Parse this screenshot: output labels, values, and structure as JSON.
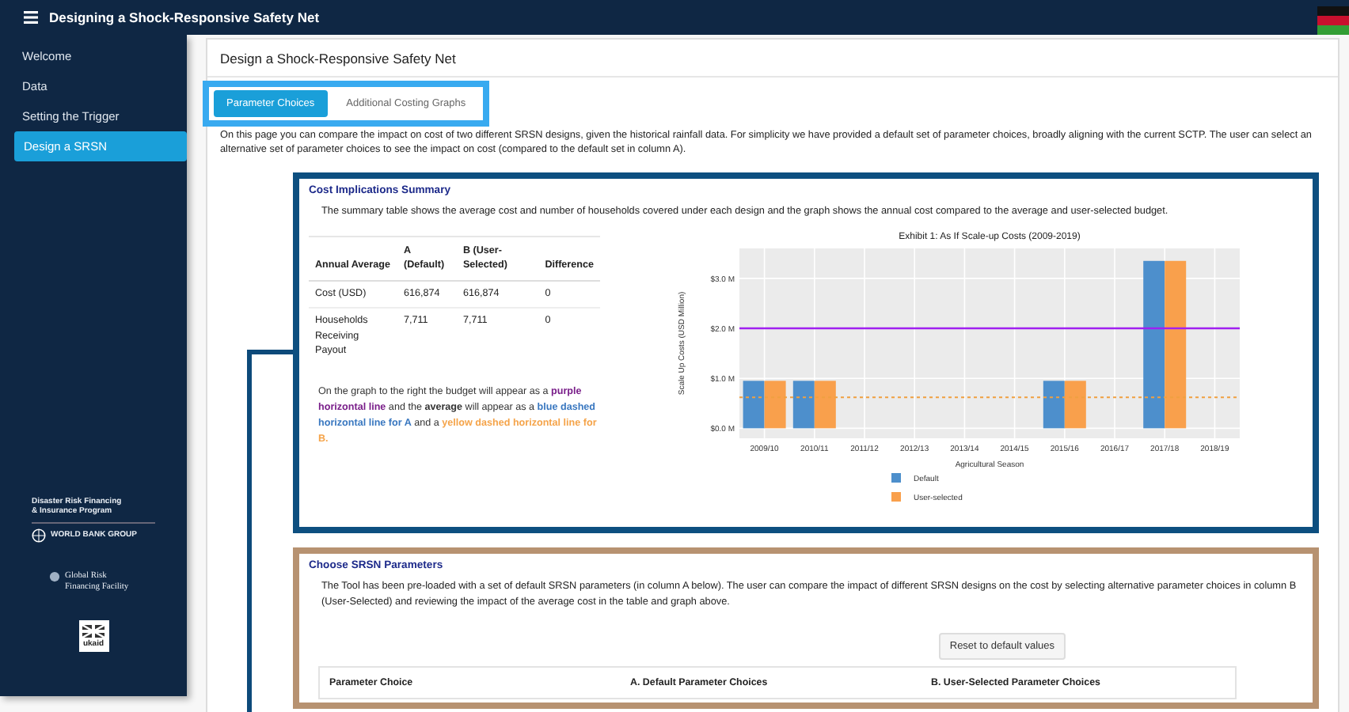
{
  "top_bar": {
    "title": "Designing a Shock-Responsive Safety Net"
  },
  "sidebar": {
    "items": [
      {
        "label": "Welcome",
        "selected": false
      },
      {
        "label": "Data",
        "selected": false
      },
      {
        "label": "Setting the Trigger",
        "selected": false
      },
      {
        "label": "Design a SRSN",
        "selected": true
      }
    ],
    "logos": [
      {
        "kind": "drfip",
        "lines": [
          "Disaster Risk Financing",
          "& Insurance Program"
        ],
        "sub": "WORLD BANK GROUP"
      },
      {
        "kind": "grff",
        "lines": [
          "Global Risk",
          "Financing Facility"
        ]
      },
      {
        "kind": "ukaid",
        "lines": [
          "ukaid"
        ]
      }
    ]
  },
  "page": {
    "title": "Design a Shock-Responsive Safety Net",
    "tabs": [
      {
        "label": "Parameter Choices",
        "selected": true
      },
      {
        "label": "Additional Costing Graphs",
        "selected": false
      }
    ],
    "intro": "On this page you can compare the impact on cost of two different SRSN designs, given the historical rainfall data. For simplicity we have provided a default set of parameter choices, broadly aligning with the current SCTP. The user can select an alternative set of parameter choices to see the impact on cost (compared to the default set in column A)."
  },
  "cost_summary": {
    "title": "Cost Implications Summary",
    "description": "The summary table shows the average cost and number of households covered under each design and the graph shows the annual cost compared to the average and user-selected budget.",
    "table": {
      "columns": [
        "Annual Average",
        "A (Default)",
        "B (User-Selected)",
        "Difference"
      ],
      "rows": [
        [
          "Cost (USD)",
          "616,874",
          "616,874",
          "0"
        ],
        [
          "Households Receiving Payout",
          "7,711",
          "7,711",
          "0"
        ]
      ]
    },
    "legend_note": [
      {
        "text": "On the graph to the right the budget will appear as a ",
        "kind": "plain"
      },
      {
        "text": "purple horizontal line",
        "kind": "budget"
      },
      {
        "text": " and the ",
        "kind": "plain"
      },
      {
        "text": "average",
        "kind": "emphasis"
      },
      {
        "text": " will appear as a ",
        "kind": "plain"
      },
      {
        "text": "blue dashed horizontal line for A",
        "kind": "series_a"
      },
      {
        "text": " and a ",
        "kind": "plain"
      },
      {
        "text": "yellow dashed horizontal line for B.",
        "kind": "series_b"
      }
    ],
    "chart_data": {
      "type": "bar",
      "title": "Exhibit 1: As If Scale-up Costs (2009-2019)",
      "xlabel": "Agricultural Season",
      "ylabel": "Scale Up Costs (USD Million)",
      "categories": [
        "2009/10",
        "2010/11",
        "2011/12",
        "2012/13",
        "2013/14",
        "2014/15",
        "2015/16",
        "2016/17",
        "2017/18",
        "2018/19"
      ],
      "series": [
        {
          "name": "Default",
          "color": "#4d8fcc",
          "values": [
            0.95,
            0.95,
            0,
            0,
            0,
            0,
            0.95,
            0,
            3.35,
            0
          ]
        },
        {
          "name": "User-selected",
          "color": "#f9a04c",
          "values": [
            0.95,
            0.95,
            0,
            0,
            0,
            0,
            0.95,
            0,
            3.35,
            0
          ]
        }
      ],
      "ylim": [
        -0.2,
        3.6
      ],
      "yticks": [
        {
          "value": 0,
          "label": "$0.0 M"
        },
        {
          "value": 1,
          "label": "$1.0 M"
        },
        {
          "value": 2,
          "label": "$2.0 M"
        },
        {
          "value": 3,
          "label": "$3.0 M"
        }
      ],
      "grid": true,
      "legend": true,
      "ref_lines": [
        {
          "axis": "y",
          "value": 2.0,
          "color": "#a020f0"
        },
        {
          "axis": "y",
          "value": 0.62,
          "color": "#f0a040"
        }
      ]
    }
  },
  "parameters": {
    "title": "Choose SRSN Parameters",
    "description": "The Tool has been pre-loaded with a set of default SRSN parameters (in column A below). The user can compare the impact of different SRSN designs on the cost by selecting alternative parameter choices in column B (User-Selected) and reviewing the impact of the average cost in the table and graph above.",
    "reset_button": "Reset to default values",
    "columns": [
      "Parameter Choice",
      "A. Default Parameter Choices",
      "B. User-Selected Parameter Choices"
    ]
  }
}
